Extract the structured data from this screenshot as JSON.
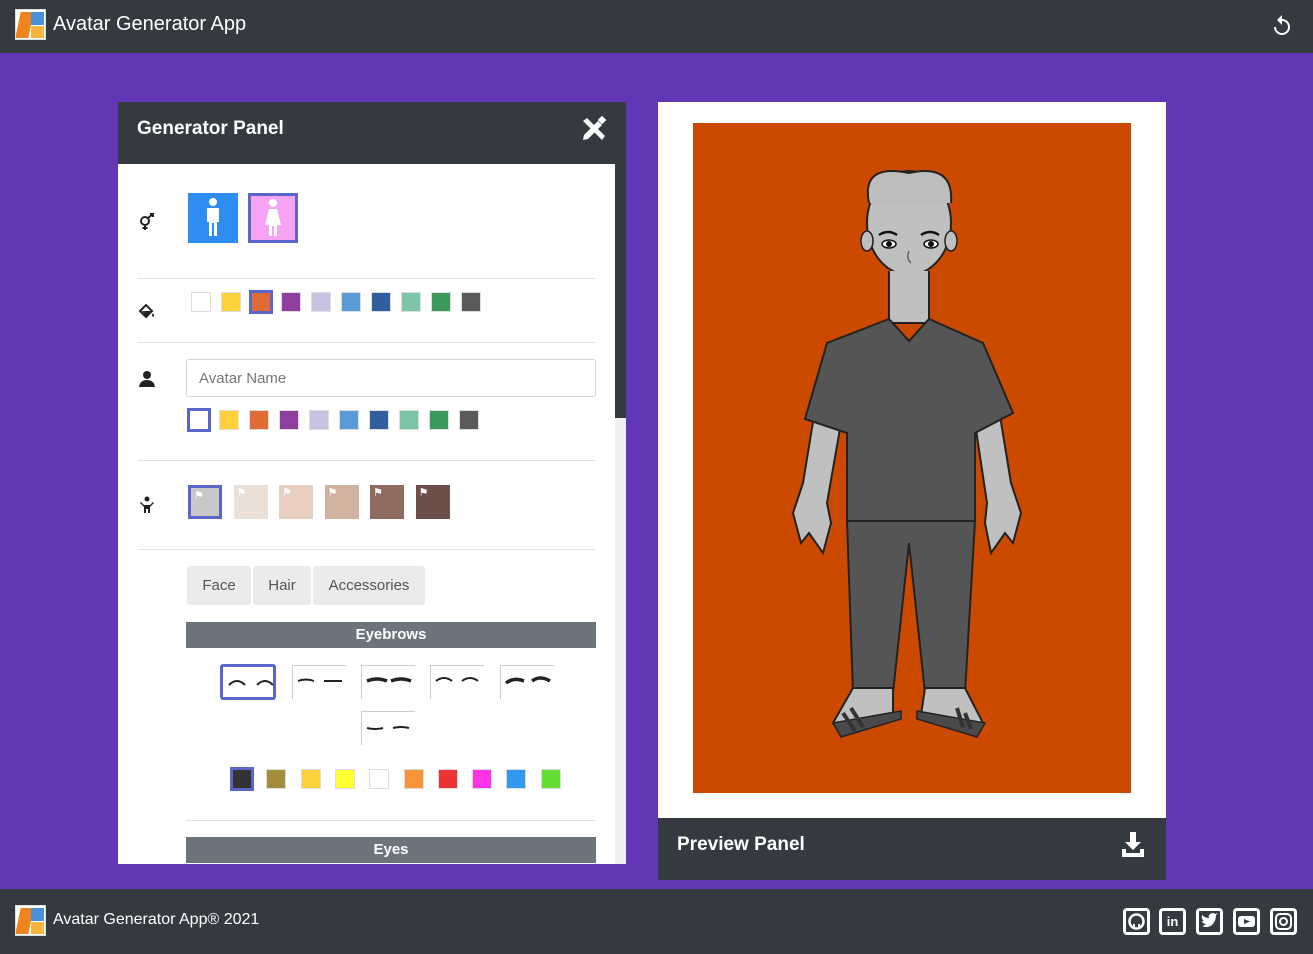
{
  "header": {
    "title": "Avatar Generator App",
    "reset_icon": "undo-icon"
  },
  "generator": {
    "title": "Generator Panel",
    "icon": "tools-icon",
    "gender": {
      "icon": "gender-icon",
      "options": [
        {
          "name": "male",
          "color": "#2f8cf1",
          "selected": false
        },
        {
          "name": "female",
          "color": "#f5a3f2",
          "selected": true
        }
      ]
    },
    "background": {
      "icon": "paint-bucket-icon",
      "colors": [
        "#ffffff",
        "#fdd13a",
        "#e06b35",
        "#8e3fa0",
        "#c7c2e0",
        "#5b9bd5",
        "#2f5f9e",
        "#7cc5a8",
        "#3b9a5c",
        "#5a5a5a"
      ],
      "selected_index": 2
    },
    "name": {
      "icon": "user-icon",
      "placeholder": "Avatar Name",
      "value": "",
      "colors": [
        "#ffffff",
        "#fdd13a",
        "#e06b35",
        "#8e3fa0",
        "#c7c2e0",
        "#5b9bd5",
        "#2f5f9e",
        "#7cc5a8",
        "#3b9a5c",
        "#5a5a5a"
      ],
      "selected_index": 0
    },
    "skin": {
      "icon": "person-icon",
      "tones": [
        "#c8c8c8",
        "#ece0d6",
        "#e8cfc0",
        "#cfb3a0",
        "#8f6b60",
        "#6b4f48"
      ],
      "selected_index": 0
    },
    "tabs": [
      "Face",
      "Hair",
      "Accessories"
    ],
    "eyebrows": {
      "label": "Eyebrows",
      "options_count": 6,
      "selected_index": 0,
      "colors": [
        "#333333",
        "#a38c3a",
        "#fdd13a",
        "#ffff33",
        "#ffffff",
        "#f7943a",
        "#ee3333",
        "#ff33e6",
        "#3399ee",
        "#66dd33"
      ],
      "selected_color_index": 0
    },
    "eyes": {
      "label": "Eyes"
    }
  },
  "preview": {
    "title": "Preview Panel",
    "download_icon": "download-icon",
    "background_color": "#cc4a00"
  },
  "footer": {
    "text": "Avatar Generator App® 2021",
    "social": [
      "github-icon",
      "linkedin-icon",
      "twitter-icon",
      "youtube-icon",
      "instagram-icon"
    ]
  }
}
